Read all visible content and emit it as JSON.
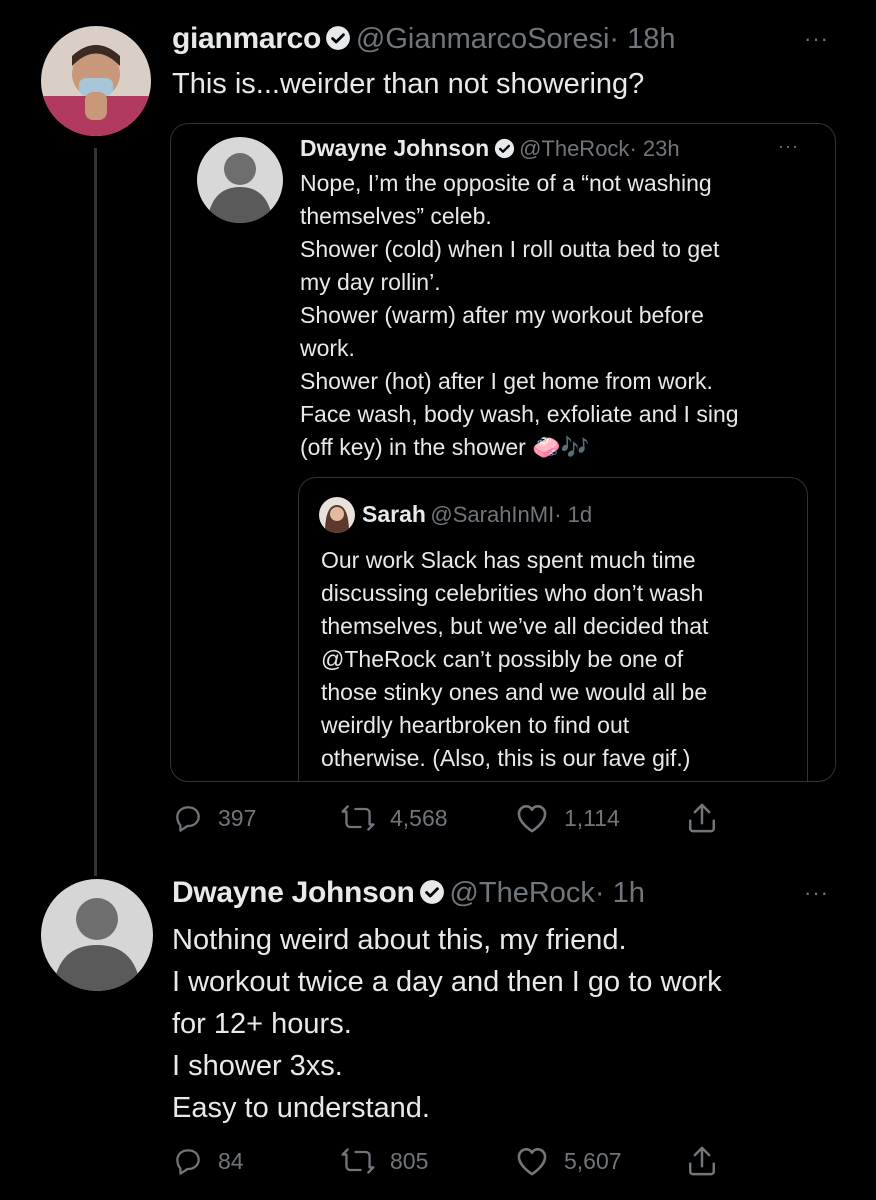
{
  "tweet1": {
    "name": "gianmarco",
    "handle": "@GianmarcoSoresi",
    "time": "· 18h",
    "text": "This is...weirder than not showering?",
    "more": "···"
  },
  "quote1": {
    "name": "Dwayne Johnson",
    "handle": "@TheRock",
    "time": "· 23h",
    "more": "···",
    "lines": [
      "Nope, I’m the opposite of a “not washing",
      "themselves” celeb.",
      "Shower (cold) when I roll outta bed to get",
      "my day rollin’.",
      "Shower (warm) after my workout before",
      "work.",
      "Shower (hot) after I get home from work.",
      "Face wash, body wash, exfoliate and I sing",
      "(off key) in the shower"
    ],
    "emoji": "🧼🎶"
  },
  "quote2": {
    "name": "Sarah",
    "handle": "@SarahInMI",
    "time": "· 1d",
    "lines": [
      "Our work Slack has spent much time",
      "discussing celebrities who don’t wash",
      "themselves, but we’ve all decided that",
      "@TheRock can’t possibly be one of",
      "those stinky ones and we would all be",
      "weirdly heartbroken to find out",
      "otherwise. (Also, this is our fave gif.)"
    ]
  },
  "actions1": {
    "replies": "397",
    "retweets": "4,568",
    "likes": "1,114"
  },
  "tweet2": {
    "name": "Dwayne Johnson",
    "handle": "@TheRock",
    "time": "· 1h",
    "more": "···",
    "lines": [
      "Nothing weird about this, my friend.",
      "I workout twice a day and then I go to work",
      "for 12+ hours.",
      "I shower 3xs.",
      "Easy to understand."
    ]
  },
  "actions2": {
    "replies": "84",
    "retweets": "805",
    "likes": "5,607"
  },
  "colors": {
    "background": "#000000",
    "text": "#e7e9ea",
    "muted": "#71767b",
    "border": "#2f3336"
  }
}
